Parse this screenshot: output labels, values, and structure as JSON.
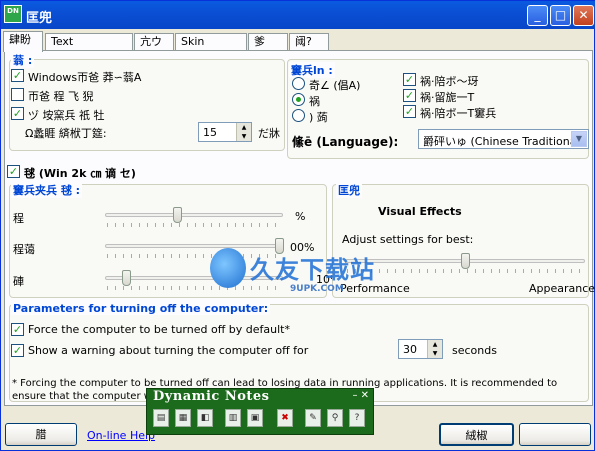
{
  "titlebar": {
    "icon_text": "DN",
    "title": "匡兜",
    "min": "_",
    "max": "□",
    "close": "✕"
  },
  "tabs": [
    "肆盼",
    "Text parameters",
    "亢ウ",
    "Skin Browser",
    "爹",
    "阈?"
  ],
  "general": {
    "group_label": "蓊 :",
    "opt1": "Windows帀爸   莽∽蓊A",
    "opt2": "帀爸   程   飞   猊",
    "opt3": "ヅ      垵窯兵    祇    牡",
    "spin_label": "Ω蠡睚    緕栿丁筵:",
    "spin_value": "15",
    "spin_unit": "だ牀"
  },
  "window": {
    "group_label": "窶兵ln :",
    "radio1": "奇∠ (倡A)",
    "radio2": "祸",
    "radio3": ")  蒟",
    "cb1": "祸·陪ボ～玡",
    "cb2": "祸·留旎一T",
    "cb3": "祸·陪ボ一T窶兵",
    "lang_label": "絛ē (Language):",
    "lang_value": "爵砰いゅ (Chinese Traditional"
  },
  "startup": {
    "label": "毬      (Win 2k ㎝    谪    セ)"
  },
  "transparency": {
    "group_label": "窶兵夹兵   毬     :",
    "rows": [
      {
        "label": "程",
        "value": "%",
        "level": 0.4
      },
      {
        "label": "程蔼",
        "value": "00%",
        "level": 1.0
      },
      {
        "label": "硨",
        "value": "10%",
        "level": 0.1
      }
    ]
  },
  "effects": {
    "group_label": "匡兜",
    "title": "Visual Effects",
    "subtitle": "Adjust settings for best:",
    "left": "Performance",
    "right": "Appearance",
    "level": 0.5
  },
  "watermark": {
    "text": "久友下载站",
    "url": "9UPK.COM"
  },
  "shutdown": {
    "group_label": "Parameters for turning off the computer:",
    "cb1": "Force the computer to be turned off by default*",
    "cb2": "Show a warning about turning the computer off for",
    "seconds_value": "30",
    "seconds_unit": "seconds",
    "note": "* Forcing the computer to be turned off can lead to losing data in running applications. It is recommended to ensure that the computer will be turned o"
  },
  "buttons": {
    "left": "腊",
    "help": "On-line Help",
    "ok": "絨椒",
    "cancel": ""
  },
  "dynamic_notes": {
    "title": "Dynamic Notes",
    "controls": "– ✕",
    "icons": [
      "▤",
      "▦",
      "◧",
      "▥",
      "▣",
      "✖",
      "✎",
      "⚲",
      "?"
    ]
  }
}
